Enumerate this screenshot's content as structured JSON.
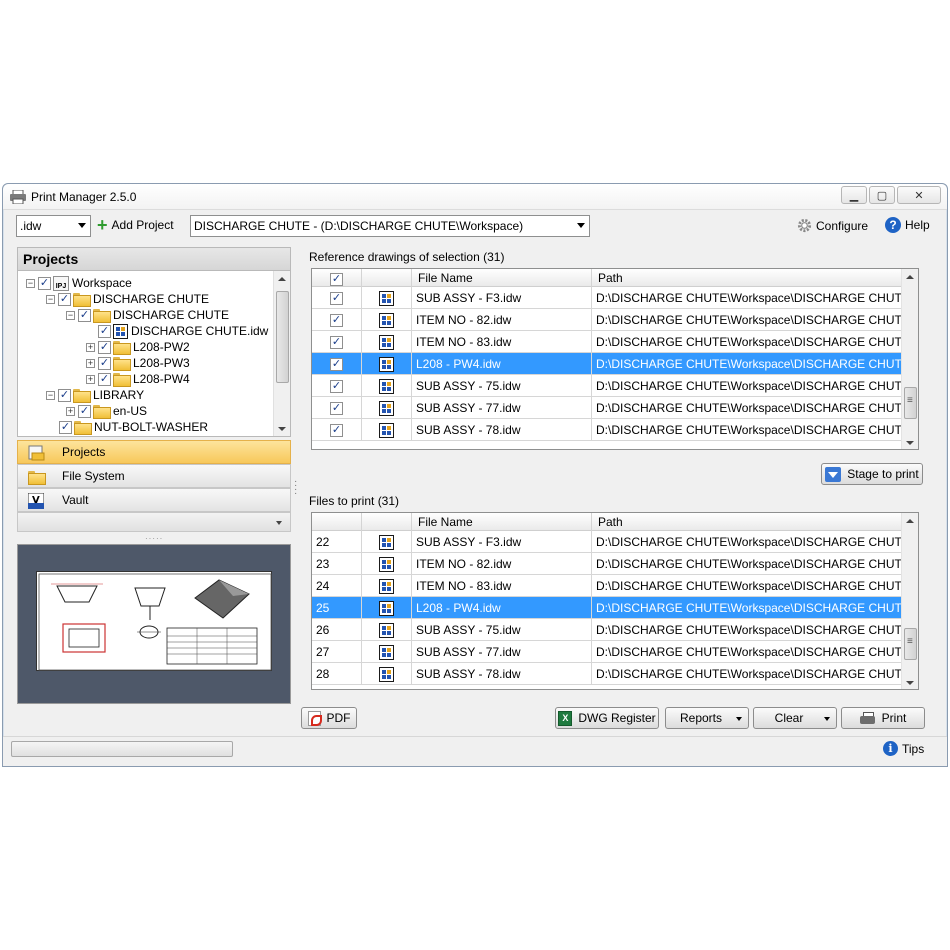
{
  "window": {
    "title": "Print Manager 2.5.0"
  },
  "toolbar": {
    "filetype": ".idw",
    "add_project": "Add Project",
    "project_select": "DISCHARGE CHUTE  -  (D:\\DISCHARGE CHUTE\\Workspace)",
    "configure": "Configure",
    "help": "Help"
  },
  "left": {
    "header": "Projects",
    "tree": [
      {
        "label": "Workspace"
      },
      {
        "label": "DISCHARGE CHUTE"
      },
      {
        "label": "DISCHARGE CHUTE"
      },
      {
        "label": "DISCHARGE CHUTE.idw"
      },
      {
        "label": "L208-PW2"
      },
      {
        "label": "L208-PW3"
      },
      {
        "label": "L208-PW4"
      },
      {
        "label": "LIBRARY"
      },
      {
        "label": "en-US"
      },
      {
        "label": "NUT-BOLT-WASHER"
      }
    ],
    "nav": {
      "projects": "Projects",
      "filesystem": "File System",
      "vault": "Vault"
    }
  },
  "reference": {
    "label": "Reference drawings of selection (31)",
    "col_file": "File Name",
    "col_path": "Path",
    "rows": [
      {
        "name": "SUB ASSY - F3.idw",
        "path": "D:\\DISCHARGE CHUTE\\Workspace\\DISCHARGE CHUTE\\..."
      },
      {
        "name": "ITEM NO - 82.idw",
        "path": "D:\\DISCHARGE CHUTE\\Workspace\\DISCHARGE CHUTE\\..."
      },
      {
        "name": "ITEM NO - 83.idw",
        "path": "D:\\DISCHARGE CHUTE\\Workspace\\DISCHARGE CHUTE\\..."
      },
      {
        "name": "L208 - PW4.idw",
        "path": "D:\\DISCHARGE CHUTE\\Workspace\\DISCHARGE CHUTE\\..."
      },
      {
        "name": "SUB ASSY - 75.idw",
        "path": "D:\\DISCHARGE CHUTE\\Workspace\\DISCHARGE CHUTE\\..."
      },
      {
        "name": "SUB ASSY - 77.idw",
        "path": "D:\\DISCHARGE CHUTE\\Workspace\\DISCHARGE CHUTE\\..."
      },
      {
        "name": "SUB ASSY - 78.idw",
        "path": "D:\\DISCHARGE CHUTE\\Workspace\\DISCHARGE CHUTE\\..."
      }
    ],
    "stage_button": "Stage to print"
  },
  "files": {
    "label": "Files to print (31)",
    "col_file": "File Name",
    "col_path": "Path",
    "rows": [
      {
        "num": "22",
        "name": "SUB ASSY - F3.idw",
        "path": "D:\\DISCHARGE CHUTE\\Workspace\\DISCHARGE CHUTE\\..."
      },
      {
        "num": "23",
        "name": "ITEM NO - 82.idw",
        "path": "D:\\DISCHARGE CHUTE\\Workspace\\DISCHARGE CHUTE\\..."
      },
      {
        "num": "24",
        "name": "ITEM NO - 83.idw",
        "path": "D:\\DISCHARGE CHUTE\\Workspace\\DISCHARGE CHUTE\\..."
      },
      {
        "num": "25",
        "name": "L208 - PW4.idw",
        "path": "D:\\DISCHARGE CHUTE\\Workspace\\DISCHARGE CHUTE\\..."
      },
      {
        "num": "26",
        "name": "SUB ASSY - 75.idw",
        "path": "D:\\DISCHARGE CHUTE\\Workspace\\DISCHARGE CHUTE\\..."
      },
      {
        "num": "27",
        "name": "SUB ASSY - 77.idw",
        "path": "D:\\DISCHARGE CHUTE\\Workspace\\DISCHARGE CHUTE\\..."
      },
      {
        "num": "28",
        "name": "SUB ASSY - 78.idw",
        "path": "D:\\DISCHARGE CHUTE\\Workspace\\DISCHARGE CHUTE\\..."
      }
    ]
  },
  "actions": {
    "pdf": "PDF",
    "dwg_register": "DWG Register",
    "reports": "Reports",
    "clear": "Clear",
    "print": "Print"
  },
  "status": {
    "tips": "Tips"
  },
  "colors": {
    "selection": "#3399ff",
    "active_nav": "#f7c85a",
    "accent": "#1e63c5"
  }
}
